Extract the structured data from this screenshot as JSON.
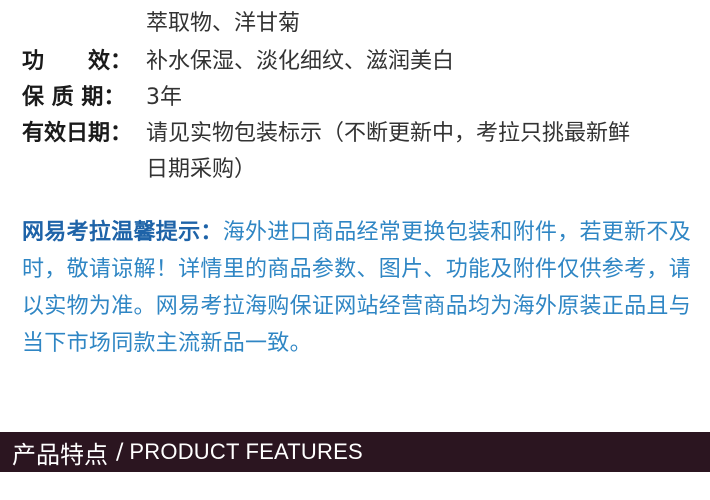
{
  "specs": {
    "partial_top": "萃取物、洋甘菊",
    "efficacy_label": "功　　效：",
    "efficacy_value": "补水保湿、淡化细纹、滋润美白",
    "shelf_label": "保  质  期：",
    "shelf_value": "3年",
    "date_label": "有效日期：",
    "date_value_line1": "请见实物包装标示（不断更新中，考拉只挑最新鲜",
    "date_value_line2": "日期采购）"
  },
  "notice": {
    "title": "网易考拉温馨提示：",
    "body": "海外进口商品经常更换包装和附件，若更新不及时，敬请谅解！详情里的商品参数、图片、功能及附件仅供参考，请以实物为准。网易考拉海购保证网站经营商品均为海外原装正品且与当下市场同款主流新品一致。"
  },
  "banner": {
    "title_cn": "产品特点",
    "separator": "/",
    "title_en": "PRODUCT FEATURES"
  },
  "colors": {
    "notice_text": "#2f86c4",
    "notice_title": "#1e63a8",
    "banner_bg": "#2b1520"
  }
}
